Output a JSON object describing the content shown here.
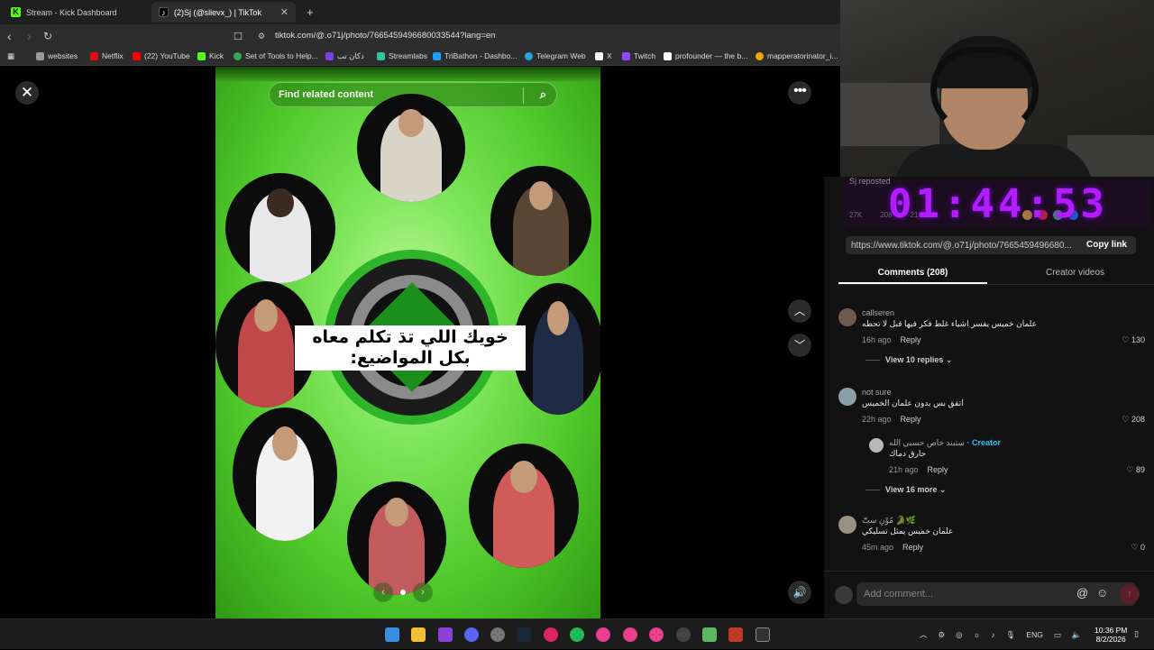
{
  "browser": {
    "tabs": [
      {
        "title": "Stream - Kick Dashboard",
        "icon": "kick-icon"
      },
      {
        "title": "(2)Sj (@slievx_) | TikTok",
        "icon": "tiktok-icon"
      }
    ],
    "new_tab": "+",
    "url": "tiktok.com/@.o71j/photo/7665459496680033544?lang=en",
    "bookmarks": [
      {
        "label": "websites",
        "color": "#999999"
      },
      {
        "label": "Netflix",
        "color": "#e50914"
      },
      {
        "label": "(22) YouTube",
        "color": "#ff0000"
      },
      {
        "label": "Kick",
        "color": "#53fc18"
      },
      {
        "label": "Set of Tools to Help...",
        "color": "#34a853"
      },
      {
        "label": "دكان تب",
        "color": "#7b3fe4"
      },
      {
        "label": "Streamlabs",
        "color": "#31c3a2"
      },
      {
        "label": "TriBathon - Dashbo...",
        "color": "#1f9ef5"
      },
      {
        "label": "Telegram Web",
        "color": "#2aa3df"
      },
      {
        "label": "X",
        "color": "#ffffff"
      },
      {
        "label": "Twitch",
        "color": "#9146ff"
      },
      {
        "label": "profounder — the b...",
        "color": "#ffffff"
      },
      {
        "label": "mapperatorinator_i...",
        "color": "#f2a900"
      }
    ]
  },
  "viewer": {
    "search_placeholder": "Find related content",
    "caption": "خويك اللي تڌ   تكلم معاه بكل المواضيع:",
    "pager_prev": "‹",
    "pager_next": "›"
  },
  "stream_overlay": {
    "timer": "01:44:53",
    "repost": "Sj reposted",
    "stats": [
      "27K",
      "208",
      "21"
    ]
  },
  "share": {
    "link": "https://www.tiktok.com/@.o71j/photo/7665459496680...",
    "copy_label": "Copy link"
  },
  "panel_tabs": {
    "comments": "Comments (208)",
    "creator": "Creator videos"
  },
  "comments": [
    {
      "user": "callseren",
      "text": "علمان خميس يفسر اشياء غلط فكر فيها قبل لا تحطه",
      "time": "16h ago",
      "reply": "Reply",
      "likes": "130",
      "more": "View 10 replies"
    },
    {
      "user": "not sure",
      "text": "اتفق بس بدون علمان الخميس",
      "time": "22h ago",
      "reply": "Reply",
      "likes": "208"
    },
    {
      "user": "ستبند خاص حسبي الله",
      "creator_tag": "· Creator",
      "text": "حارق دماك",
      "time": "21h ago",
      "reply": "Reply",
      "likes": "89",
      "more": "View 16 more"
    },
    {
      "user": "مُوْنِ ستّٓ 🐊🌿",
      "text": "علمان خميس يمثل تسليكي",
      "time": "45m ago",
      "reply": "Reply",
      "likes": "0"
    }
  ],
  "add_comment": {
    "placeholder": "Add comment...",
    "at": "@",
    "emoji": "☺",
    "send": "↑"
  },
  "taskbar": {
    "lang": "ENG",
    "time": "10:36 PM",
    "date": "8/2/2026"
  }
}
